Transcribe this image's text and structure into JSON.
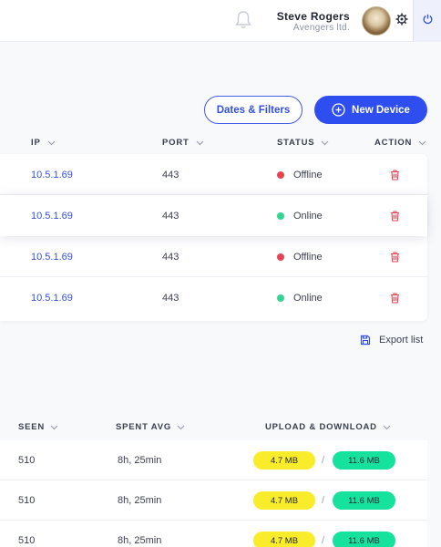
{
  "header": {
    "user_name": "Steve Rogers",
    "user_org": "Avengers ltd.",
    "icons": [
      "bell-icon",
      "gear-icon",
      "power-icon"
    ]
  },
  "actions": {
    "filters_label": "Dates & Filters",
    "new_device_label": "New Device"
  },
  "devices_table": {
    "columns": [
      "IP",
      "PORT",
      "STATUS",
      "ACTION"
    ],
    "rows": [
      {
        "ip": "10.5.1.69",
        "port": "443",
        "status": "Offline",
        "status_color": "#e64353"
      },
      {
        "ip": "10.5.1.69",
        "port": "443",
        "status": "Online",
        "status_color": "#34d392"
      },
      {
        "ip": "10.5.1.69",
        "port": "443",
        "status": "Offline",
        "status_color": "#e64353"
      },
      {
        "ip": "10.5.1.69",
        "port": "443",
        "status": "Online",
        "status_color": "#34d392"
      }
    ]
  },
  "export_label": "Export list",
  "usage_table": {
    "columns": [
      "SEEN",
      "SPENT AVG",
      "UPLOAD & DOWNLOAD"
    ],
    "rows": [
      {
        "seen": "510",
        "spent": "8h, 25min",
        "upload": "4.7 MB",
        "download": "11.6 MB"
      },
      {
        "seen": "510",
        "spent": "8h, 25min",
        "upload": "4.7 MB",
        "download": "11.6 MB"
      },
      {
        "seen": "510",
        "spent": "8h, 25min",
        "upload": "4.7 MB",
        "download": "11.6 MB"
      }
    ],
    "separator": "/"
  },
  "colors": {
    "accent": "#2f4ef0",
    "offline": "#e64353",
    "online": "#34d392",
    "upload_pill": "#f9ed2b",
    "download_pill": "#14e29d"
  }
}
